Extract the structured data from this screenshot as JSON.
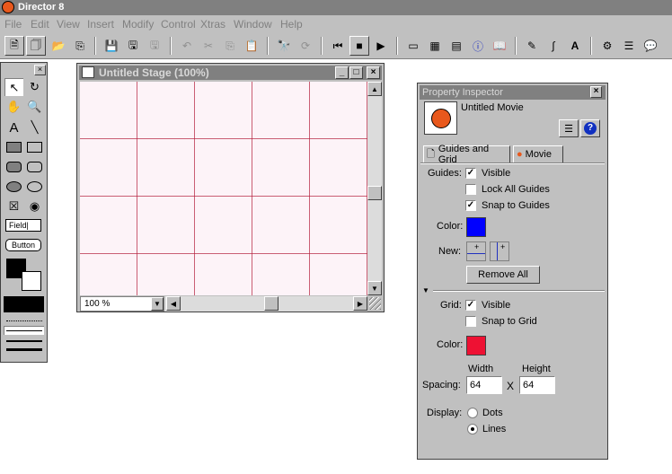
{
  "app": {
    "title": "Director 8"
  },
  "menubar": {
    "items": [
      "File",
      "Edit",
      "View",
      "Insert",
      "Modify",
      "Control",
      "Xtras",
      "Window",
      "Help"
    ]
  },
  "toolbar": {
    "buttons": [
      "new-movie-icon",
      "new-cast-icon",
      "open-icon",
      "import-icon",
      "save-icon",
      "save-all-icon",
      "save-and-compact-icon",
      "undo-icon",
      "cut-icon",
      "copy-icon",
      "paste-icon",
      "find-icon",
      "exchange-cast-members-icon",
      "rewind-icon",
      "stop-icon",
      "play-icon",
      "stage-window-icon",
      "cast-window-icon",
      "score-window-icon",
      "property-inspector-icon",
      "library-palette-icon",
      "paint-window-icon",
      "vector-shape-icon",
      "text-window-icon",
      "script-icon",
      "message-window-icon",
      "behavior-inspector-icon"
    ]
  },
  "tools": {
    "field_label": "Field",
    "button_label": "Button"
  },
  "stage": {
    "title": "Untitled Stage (100%)",
    "zoom": "100 %"
  },
  "inspector": {
    "title": "Property Inspector",
    "movie_name": "Untitled Movie",
    "tabs": [
      "Guides and Grid",
      "Movie"
    ],
    "guides": {
      "label": "Guides:",
      "visible": {
        "label": "Visible",
        "checked": true
      },
      "lock_all": {
        "label": "Lock All Guides",
        "checked": false
      },
      "snap": {
        "label": "Snap to Guides",
        "checked": true
      },
      "color_label": "Color:",
      "color": "#0000ff",
      "new_label": "New:",
      "remove_all": "Remove All"
    },
    "grid": {
      "label": "Grid:",
      "visible": {
        "label": "Visible",
        "checked": true
      },
      "snap": {
        "label": "Snap to Grid",
        "checked": false
      },
      "color_label": "Color:",
      "color": "#ee1133",
      "spacing_label": "Spacing:",
      "width_label": "Width",
      "height_label": "Height",
      "width": "64",
      "height": "64",
      "x_label": "X",
      "display_label": "Display:",
      "dots_label": "Dots",
      "lines_label": "Lines",
      "display_selected": "Lines"
    }
  }
}
